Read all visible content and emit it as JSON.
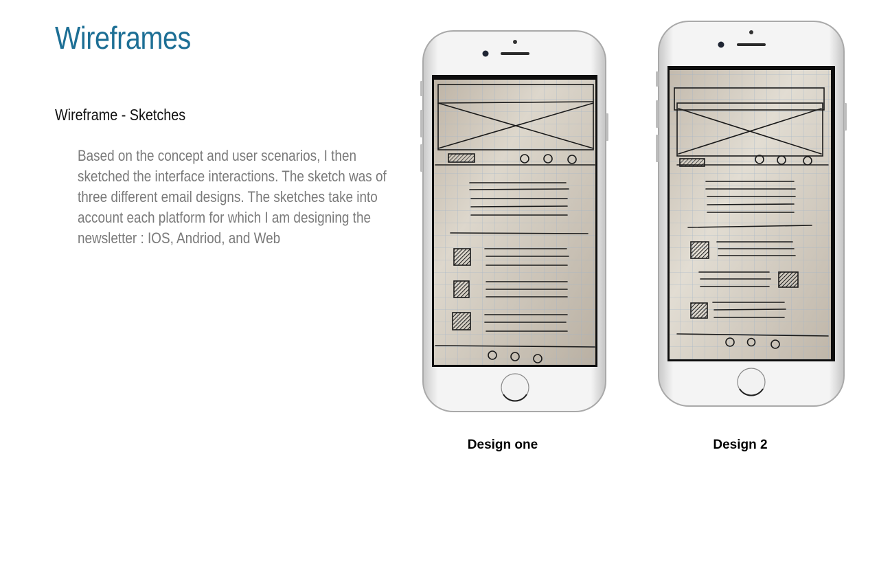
{
  "page": {
    "title": "Wireframes"
  },
  "section": {
    "heading": "Wireframe - Sketches",
    "body": "Based on the concept and user scenarios, I then sketched the interface interactions. The sketch was of three different email designs. The sketches take into account each platform for which I am designing the newsletter : IOS, Andriod, and Web"
  },
  "designs": [
    {
      "caption": "Design one"
    },
    {
      "caption": "Design 2"
    }
  ],
  "colors": {
    "title": "#1d6f95",
    "heading": "#111111",
    "body": "#7a7a7a",
    "paper": "#c9c0b4",
    "grid": "#9fb3c8",
    "ink": "#1a1a1a"
  }
}
